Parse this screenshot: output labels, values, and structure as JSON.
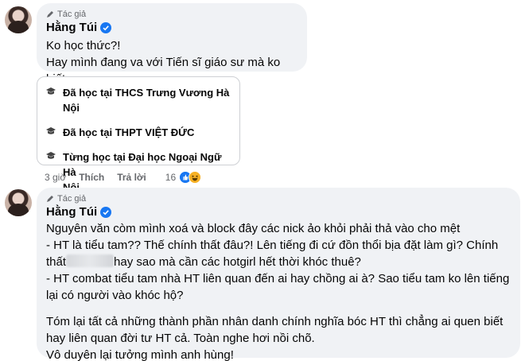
{
  "comment1": {
    "author_tag": "Tác giả",
    "author_name": "Hằng Túi",
    "lines": [
      "Ko học thức?!",
      "Hay mình đang va với Tiến sĩ giáo sư mà ko biết"
    ],
    "edu": [
      {
        "line1": "Đã học tại THCS Trưng Vương Hà",
        "line2": "Nội"
      },
      {
        "line1": "Đã học tại THPT VIỆT ĐỨC",
        "line2": ""
      },
      {
        "line1": "Từng học tại Đại học Ngoại Ngữ Hà",
        "line2": "Nội"
      }
    ],
    "time": "3 giờ",
    "like_label": "Thích",
    "reply_label": "Trả lời",
    "reaction_count": "16"
  },
  "comment2": {
    "author_tag": "Tác giả",
    "author_name": "Hằng Túi",
    "p1": [
      "Nguyên văn còm mình xoá và block đây các nick ảo khỏi phải thả vào cho mệt",
      "- HT là tiểu tam?? Thế chính thất đâu?! Lên tiếng đi cứ đồn thổi bịa đặt làm gì? Chính",
      "hay sao mà cần các hotgirl hết thời khóc thuê?",
      "- HT combat tiểu tam nhà HT liên quan đến ai hay chồng ai à? Sao tiểu tam ko lên tiếng",
      "lại có người vào khóc hộ?"
    ],
    "p1_prefix": "thất",
    "p2": [
      "Tóm lại tất cả những thành phần nhân danh chính nghĩa bóc HT thì chẳng ai quen biết",
      "hay liên quan đời tư HT cả. Toàn nghe hơi nồi chõ.",
      "Vô duyên lại tưởng mình anh hùng!"
    ]
  },
  "colors": {
    "bubble": "#f0f2f5",
    "verified": "#1877f2",
    "muted": "#65676b"
  }
}
